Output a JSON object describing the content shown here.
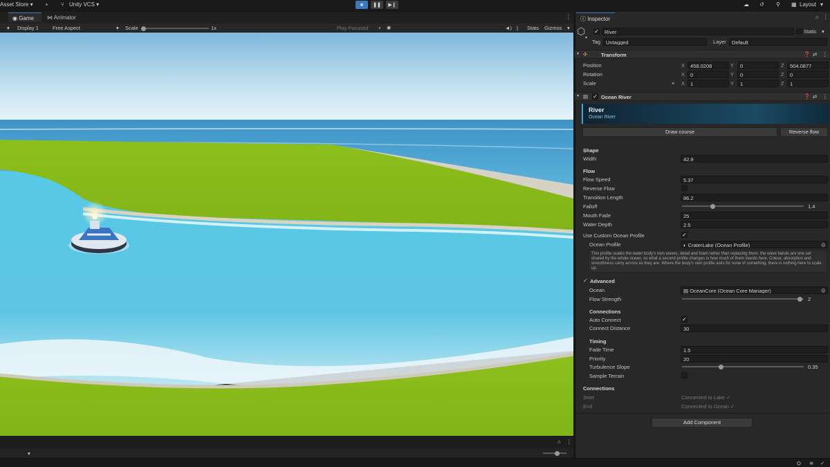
{
  "toolbar": {
    "asset_store": "Asset Store ▾",
    "vcs": "Unity VCS ▾",
    "layout": "Layout"
  },
  "tabs": {
    "game": "Game",
    "animator": "Animator",
    "inspector": "Inspector"
  },
  "gamebar": {
    "display": "Display 1",
    "aspect": "Free Aspect",
    "scale_label": "Scale",
    "scale_value": "1x",
    "play_focused": "Play Focused",
    "stats": "Stats",
    "gizmos": "Gizmos"
  },
  "object": {
    "name": "River",
    "static": "Static",
    "tag_label": "Tag",
    "tag_value": "Untagged",
    "layer_label": "Layer",
    "layer_value": "Default"
  },
  "transform": {
    "title": "Transform",
    "rows": [
      {
        "label": "Position",
        "x": "458.0208",
        "y": "0",
        "z": "504.0877"
      },
      {
        "label": "Rotation",
        "x": "0",
        "y": "0",
        "z": "0"
      },
      {
        "label": "Scale",
        "x": "1",
        "y": "1",
        "z": "1"
      }
    ]
  },
  "ocean_river": {
    "title": "Ocean River",
    "banner_title": "River",
    "banner_sub": "Ocean River",
    "draw_course": "Draw course",
    "reverse_flow": "Reverse flow",
    "shape_header": "Shape",
    "width_label": "Width",
    "width_value": "42.9",
    "flow_header": "Flow",
    "flow_speed_label": "Flow Speed",
    "flow_speed_value": "5.37",
    "reverse_flow_label": "Reverse Flow",
    "transition_label": "Transition Length",
    "transition_value": "86.2",
    "falloff_label": "Falloff",
    "falloff_value": "1.4",
    "falloff_fraction": 0.25,
    "mouth_fade_label": "Mouth Fade",
    "mouth_fade_value": "25",
    "water_depth_label": "Water Depth",
    "water_depth_value": "2.5",
    "custom_profile_label": "Use Custom Ocean Profile",
    "ocean_profile_label": "Ocean Profile",
    "ocean_profile_value": "CraterLake (Ocean Profile)",
    "help_text": "This profile scales the water body's own waves, detail and foam rather than replacing them: the wave bands are one set shared by the whole ocean, so what a second profile changes is how much of them stands here. Colour, absorption and smoothness carry across as they are. Where the body's own profile asks for none of something, there is nothing here to scale up.",
    "advanced_label": "Advanced",
    "ocean_label": "Ocean",
    "ocean_value": "OceanCore (Ocean Core Manager)",
    "flow_strength_label": "Flow Strength",
    "flow_strength_value": "2",
    "flow_strength_fraction": 0.97,
    "connections_header": "Connections",
    "auto_connect_label": "Auto Connect",
    "connect_distance_label": "Connect Distance",
    "connect_distance_value": "30",
    "timing_header": "Timing",
    "fade_time_label": "Fade Time",
    "fade_time_value": "1.5",
    "priority_label": "Priority",
    "priority_value": "20",
    "turbulence_label": "Turbulence Slope",
    "turbulence_value": "0.35",
    "turbulence_fraction": 0.32,
    "sample_terrain_label": "Sample Terrain",
    "connections2_header": "Connections",
    "start_label": "Start",
    "start_value": "Connected to Lake ✓",
    "end_label": "End",
    "end_value": "Connected to Ocean ✓",
    "add_component": "Add Component"
  },
  "colors": {
    "accent": "#3a79bb",
    "sky_top": "#9ccbe4",
    "grass": "#8cc21a",
    "water": "#4cbfe0"
  }
}
